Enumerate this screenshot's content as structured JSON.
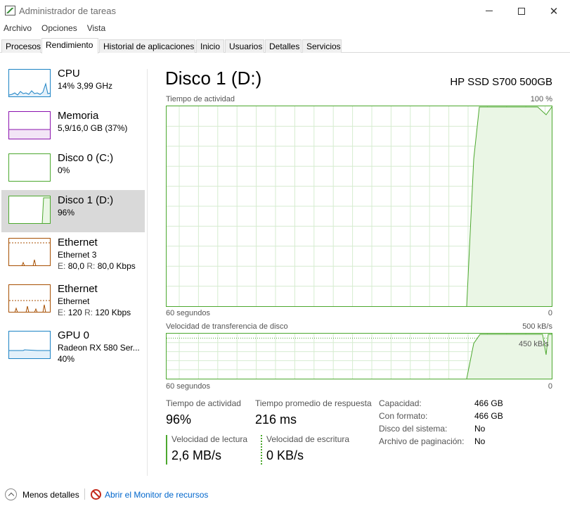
{
  "window": {
    "title": "Administrador de tareas"
  },
  "menu": [
    "Archivo",
    "Opciones",
    "Vista"
  ],
  "tabs": [
    "Procesos",
    "Rendimiento",
    "Historial de aplicaciones",
    "Inicio",
    "Usuarios",
    "Detalles",
    "Servicios"
  ],
  "active_tab": "Rendimiento",
  "sidebar": [
    {
      "title": "CPU",
      "sub1": "14%  3,99 GHz",
      "color": "#1b82c4"
    },
    {
      "title": "Memoria",
      "sub1": "5,9/16,0 GB (37%)",
      "color": "#8b12ae"
    },
    {
      "title": "Disco 0 (C:)",
      "sub1": "0%",
      "color": "#4ca82e"
    },
    {
      "title": "Disco 1 (D:)",
      "sub1": "96%",
      "color": "#4ca82e"
    },
    {
      "title": "Ethernet",
      "sub1": "Ethernet 3",
      "send_label": "E:",
      "send": "80,0",
      "recv_label": "R:",
      "recv": "80,0 Kbps",
      "color": "#a74f01"
    },
    {
      "title": "Ethernet",
      "sub1": "Ethernet",
      "send_label": "E:",
      "send": "120",
      "recv_label": "R:",
      "recv": "120 Kbps",
      "color": "#a74f01"
    },
    {
      "title": "GPU 0",
      "sub1": "Radeon RX 580 Ser...",
      "sub2": "40%",
      "color": "#1b82c4"
    }
  ],
  "main": {
    "title": "Disco 1 (D:)",
    "model": "HP SSD S700 500GB",
    "graph1": {
      "label": "Tiempo de actividad",
      "max_label": "100 %",
      "x_label": "60 segundos",
      "min_label": "0"
    },
    "graph2": {
      "label": "Velocidad de transferencia de disco",
      "max_label": "500 kB/s",
      "mid_label": "450 kB/s",
      "x_label": "60 segundos",
      "min_label": "0"
    },
    "stats": {
      "active_label": "Tiempo de actividad",
      "active_value": "96%",
      "resp_label": "Tiempo promedio de respuesta",
      "resp_value": "216 ms",
      "read_label": "Velocidad de lectura",
      "read_value": "2,6 MB/s",
      "write_label": "Velocidad de escritura",
      "write_value": "0 KB/s"
    },
    "info": [
      {
        "label": "Capacidad:",
        "value": "466 GB"
      },
      {
        "label": "Con formato:",
        "value": "466 GB"
      },
      {
        "label": "Disco del sistema:",
        "value": "No"
      },
      {
        "label": "Archivo de paginación:",
        "value": "No"
      }
    ]
  },
  "footer": {
    "less_details": "Menos detalles",
    "resource_monitor": "Abrir el Monitor de recursos"
  },
  "colors": {
    "disk": "#4ca82e",
    "disk_fill": "#eaf6e5",
    "grid": "#d6ecd0"
  }
}
